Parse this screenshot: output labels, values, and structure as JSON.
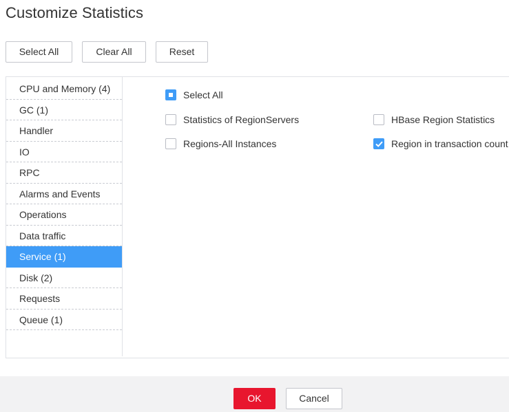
{
  "dialog": {
    "title": "Customize Statistics"
  },
  "toolbar": {
    "select_all_label": "Select All",
    "clear_all_label": "Clear All",
    "reset_label": "Reset"
  },
  "sidebar": {
    "items": [
      {
        "label": "CPU and Memory (4)",
        "active": false
      },
      {
        "label": "GC (1)",
        "active": false
      },
      {
        "label": "Handler",
        "active": false
      },
      {
        "label": "IO",
        "active": false
      },
      {
        "label": "RPC",
        "active": false
      },
      {
        "label": "Alarms and Events",
        "active": false
      },
      {
        "label": "Operations",
        "active": false
      },
      {
        "label": "Data traffic",
        "active": false
      },
      {
        "label": "Service (1)",
        "active": true
      },
      {
        "label": "Disk (2)",
        "active": false
      },
      {
        "label": "Requests",
        "active": false
      },
      {
        "label": "Queue (1)",
        "active": false
      }
    ]
  },
  "content": {
    "select_all": {
      "label": "Select All",
      "state": "partial"
    },
    "options": [
      {
        "label": "Statistics of RegionServers",
        "checked": false
      },
      {
        "label": "HBase Region Statistics",
        "checked": false
      },
      {
        "label": "Regions-All Instances",
        "checked": false
      },
      {
        "label": "Region in transaction count",
        "checked": true
      }
    ]
  },
  "footer": {
    "ok_label": "OK",
    "cancel_label": "Cancel"
  },
  "colors": {
    "accent": "#3f9cf7",
    "primary_button": "#e8162e",
    "footer_bg": "#f2f2f3"
  }
}
